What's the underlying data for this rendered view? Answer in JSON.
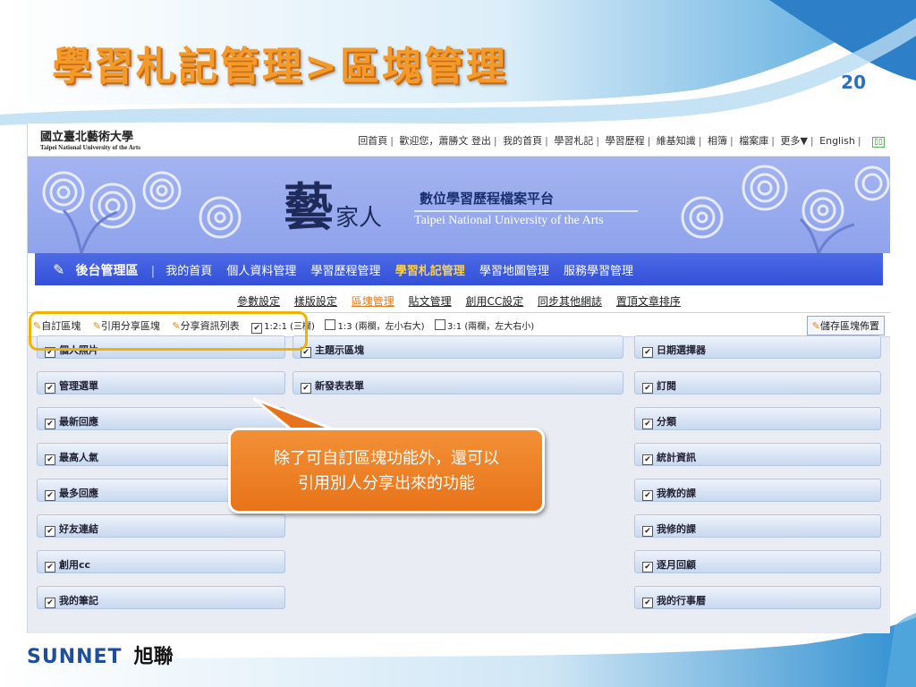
{
  "slide": {
    "title": "學習札記管理>區塊管理",
    "page_number": "20",
    "footer_brand_en": "SUNNET",
    "footer_brand_zh": "旭聯"
  },
  "university": {
    "name_zh": "國立臺北藝術大學",
    "name_en": "Taipei National University of the Arts"
  },
  "toplinks": [
    "回首頁",
    "歡迎您，蕭勝文  登出",
    "我的首頁",
    "學習札記",
    "學習歷程",
    "維基知識",
    "相簿",
    "檔案庫",
    "更多▼",
    "English"
  ],
  "banner": {
    "art_char1": "藝",
    "art_char2": "家人",
    "platform_zh": "數位學習歷程檔案平台",
    "platform_en": "Taipei National University of the Arts"
  },
  "nav": {
    "admin_label": "後台管理區",
    "items": [
      "我的首頁",
      "個人資料管理",
      "學習歷程管理",
      "學習札記管理",
      "學習地圖管理",
      "服務學習管理"
    ],
    "active_index": 3
  },
  "subtabs": {
    "items": [
      "參數設定",
      "樣版設定",
      "區塊管理",
      "貼文管理",
      "創用CC設定",
      "同步其他網誌",
      "置頂文章排序"
    ],
    "active_index": 2
  },
  "toolbar": {
    "custom_block": "自訂區塊",
    "cite_shared": "引用分享區塊",
    "share_list": "分享資訊列表",
    "layout1": "1:2:1 (三欄)",
    "layout2": "1:3 (兩欄，左小右大)",
    "layout3": "3:1 (兩欄，左大右小)",
    "save_label": "儲存區塊佈置"
  },
  "blocks": {
    "left": [
      "個人照片",
      "管理選單",
      "最新回應",
      "最高人氣",
      "最多回應",
      "好友連結",
      "創用cc",
      "我的筆記"
    ],
    "middle": [
      "主題示區塊",
      "新發表表單"
    ],
    "right": [
      "日期選擇器",
      "訂閱",
      "分類",
      "統計資訊",
      "我教的課",
      "我修的課",
      "逐月回顧",
      "我的行事曆"
    ]
  },
  "callout": {
    "line1": "除了可自訂區塊功能外，還可以",
    "line2": "引用別人分享出來的功能"
  },
  "colors": {
    "title_orange": "#f39a2a",
    "nav_blue": "#3350d8",
    "active_yellow": "#ffd23a",
    "callout_orange": "#e8731a",
    "highlight_gold": "#f0b400"
  }
}
